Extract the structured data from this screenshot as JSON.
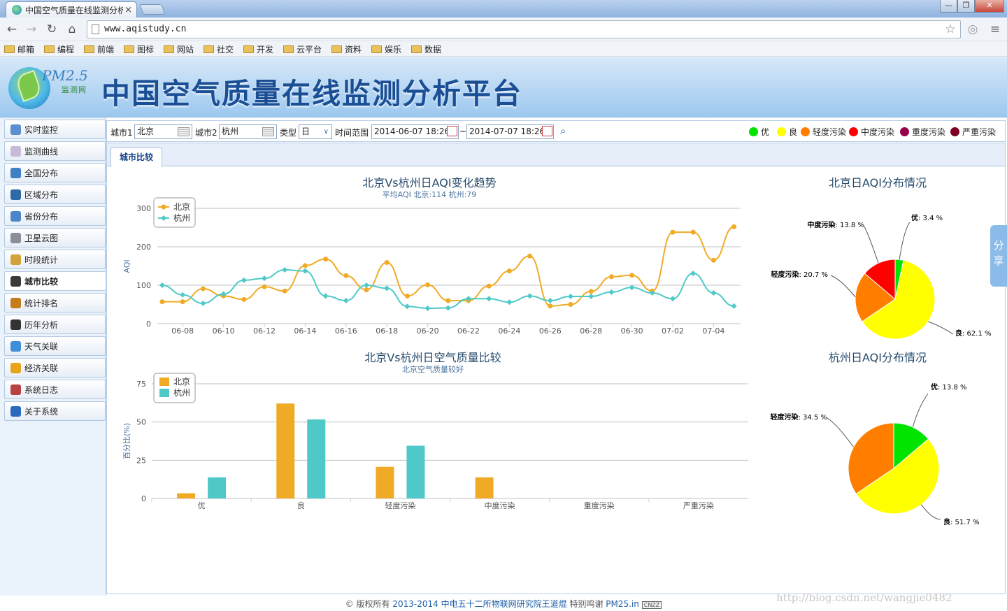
{
  "browser": {
    "tab_title": "中国空气质量在线监测分析",
    "tab_close": "×",
    "url": "www.aqistudy.cn",
    "win_minimize": "—",
    "win_restore": "❐",
    "win_close": "✕",
    "bookmarks": [
      "邮箱",
      "编程",
      "前端",
      "图标",
      "网站",
      "社交",
      "开发",
      "云平台",
      "资料",
      "娱乐",
      "数据"
    ]
  },
  "header": {
    "logo_text": "PM2.5",
    "logo_sub": "监测网",
    "site_title": "中国空气质量在线监测分析平台"
  },
  "sidebar": {
    "items": [
      {
        "label": "实时监控",
        "icon": "monitor-icon",
        "color": "#5b8fd0"
      },
      {
        "label": "监测曲线",
        "icon": "curve-icon",
        "color": "#c9b9d9"
      },
      {
        "label": "全国分布",
        "icon": "map-icon",
        "color": "#3f7fc8"
      },
      {
        "label": "区域分布",
        "icon": "region-icon",
        "color": "#2e6aa8"
      },
      {
        "label": "省份分布",
        "icon": "province-icon",
        "color": "#4a86c9"
      },
      {
        "label": "卫星云图",
        "icon": "satellite-icon",
        "color": "#8a8f99"
      },
      {
        "label": "时段统计",
        "icon": "clock-icon",
        "color": "#d2a23a"
      },
      {
        "label": "城市比较",
        "icon": "compare-icon",
        "color": "#3a3a3a"
      },
      {
        "label": "统计排名",
        "icon": "ranking-icon",
        "color": "#c47d1b"
      },
      {
        "label": "历年分析",
        "icon": "history-icon",
        "color": "#333"
      },
      {
        "label": "天气关联",
        "icon": "weather-icon",
        "color": "#3e8ed8"
      },
      {
        "label": "经济关联",
        "icon": "economy-icon",
        "color": "#e8a51a"
      },
      {
        "label": "系统日志",
        "icon": "log-icon",
        "color": "#b84242"
      },
      {
        "label": "关于系统",
        "icon": "info-icon",
        "color": "#2b6bbf"
      }
    ],
    "active_index": 7
  },
  "filters": {
    "city1_label": "城市1",
    "city1_value": "北京",
    "city2_label": "城市2",
    "city2_value": "杭州",
    "type_label": "类型",
    "type_value": "日",
    "range_label": "时间范围",
    "start": "2014-06-07 18:26",
    "tilde": "~",
    "end": "2014-07-07 18:26"
  },
  "aqi_legend": [
    {
      "label": "优",
      "color": "#00e400"
    },
    {
      "label": "良",
      "color": "#ffff00"
    },
    {
      "label": "轻度污染",
      "color": "#ff7e00"
    },
    {
      "label": "中度污染",
      "color": "#ff0000"
    },
    {
      "label": "重度污染",
      "color": "#99004c"
    },
    {
      "label": "严重污染",
      "color": "#7e0023"
    }
  ],
  "tab": {
    "label": "城市比较"
  },
  "share": {
    "label": "分享"
  },
  "footer": {
    "prefix": "© 版权所有",
    "link": "2013-2014 中电五十二所物联网研究院王道焜",
    "thanks": "特别鸣谢",
    "site": "PM25.in",
    "badge": "CNZZ"
  },
  "watermark": "http://blog.csdn.net/wangjie0482",
  "colors": {
    "beijing": "#f0ab26",
    "hangzhou": "#4ec9c8"
  },
  "chart_data": [
    {
      "type": "line",
      "title": "北京Vs杭州日AQI变化趋势",
      "subtitle": "平均AQI 北京:114 杭州:79",
      "ylabel": "AQI",
      "ylim": [
        0,
        300
      ],
      "yticks": [
        0,
        100,
        200,
        300
      ],
      "xtick_labels": [
        "06-08",
        "06-10",
        "06-12",
        "06-14",
        "06-16",
        "06-18",
        "06-20",
        "06-22",
        "06-24",
        "06-26",
        "06-28",
        "06-30",
        "07-02",
        "07-04"
      ],
      "x": [
        "06-07",
        "06-08",
        "06-09",
        "06-10",
        "06-11",
        "06-12",
        "06-13",
        "06-14",
        "06-15",
        "06-16",
        "06-17",
        "06-18",
        "06-19",
        "06-20",
        "06-21",
        "06-22",
        "06-23",
        "06-24",
        "06-25",
        "06-26",
        "06-27",
        "06-28",
        "06-29",
        "06-30",
        "07-01",
        "07-02",
        "07-03",
        "07-04",
        "07-05",
        "07-06"
      ],
      "series": [
        {
          "name": "北京",
          "values": [
            57,
            57,
            91,
            72,
            63,
            96,
            85,
            151,
            168,
            125,
            88,
            159,
            72,
            101,
            60,
            60,
            98,
            137,
            176,
            46,
            50,
            84,
            122,
            126,
            85,
            238,
            238,
            165,
            252,
            null
          ]
        },
        {
          "name": "杭州",
          "values": [
            100,
            75,
            53,
            77,
            113,
            118,
            140,
            137,
            72,
            60,
            100,
            92,
            45,
            40,
            41,
            65,
            65,
            56,
            72,
            60,
            71,
            71,
            82,
            94,
            80,
            65,
            131,
            80,
            46,
            null
          ]
        }
      ],
      "legend_position": "top-left"
    },
    {
      "type": "bar",
      "title": "北京Vs杭州日空气质量比较",
      "subtitle": "北京空气质量较好",
      "ylabel": "百分比(%)",
      "ylim": [
        0,
        75
      ],
      "yticks": [
        0,
        25,
        50,
        75
      ],
      "categories": [
        "优",
        "良",
        "轻度污染",
        "中度污染",
        "重度污染",
        "严重污染"
      ],
      "series": [
        {
          "name": "北京",
          "values": [
            3.4,
            62.1,
            20.7,
            13.8,
            0,
            0
          ]
        },
        {
          "name": "杭州",
          "values": [
            13.8,
            51.7,
            34.5,
            0,
            0,
            0
          ]
        }
      ],
      "legend_position": "top-left"
    },
    {
      "type": "pie",
      "title": "北京日AQI分布情况",
      "slices": [
        {
          "label": "优",
          "value": 3.4,
          "text": "3.4 %",
          "color": "#00e400"
        },
        {
          "label": "良",
          "value": 62.1,
          "text": "62.1 %",
          "color": "#ffff00"
        },
        {
          "label": "轻度污染",
          "value": 20.7,
          "text": "20.7 %",
          "color": "#ff7e00"
        },
        {
          "label": "中度污染",
          "value": 13.8,
          "text": "13.8 %",
          "color": "#ff0000"
        }
      ]
    },
    {
      "type": "pie",
      "title": "杭州日AQI分布情况",
      "slices": [
        {
          "label": "优",
          "value": 13.8,
          "text": "13.8 %",
          "color": "#00e400"
        },
        {
          "label": "良",
          "value": 51.7,
          "text": "51.7 %",
          "color": "#ffff00"
        },
        {
          "label": "轻度污染",
          "value": 34.5,
          "text": "34.5 %",
          "color": "#ff7e00"
        }
      ]
    }
  ]
}
